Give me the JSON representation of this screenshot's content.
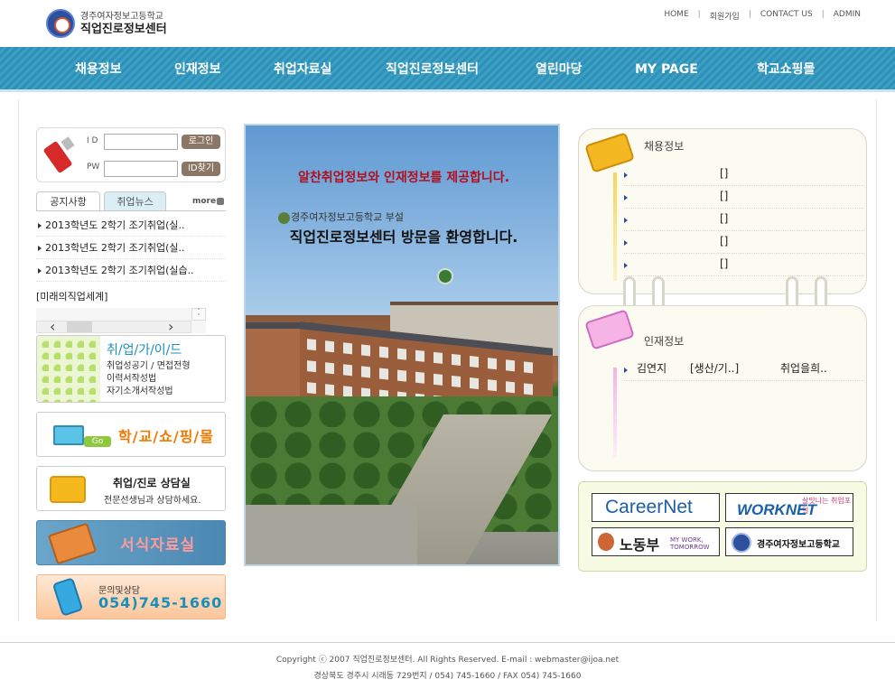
{
  "header": {
    "school_name": "경주여자정보고등학교",
    "site_name": "직업진로정보센터",
    "top_links": [
      "HOME",
      "회원가입",
      "CONTACT US",
      "ADMIN"
    ]
  },
  "nav": {
    "items": [
      "채용정보",
      "인재정보",
      "취업자료실",
      "직업진로정보센터",
      "열린마당",
      "MY PAGE",
      "학교쇼핑몰"
    ]
  },
  "login": {
    "id_label": "I D",
    "pw_label": "PW",
    "login_button": "로그인",
    "find_id_button": "ID찾기"
  },
  "news": {
    "tabs": [
      "공지사항",
      "취업뉴스"
    ],
    "more_label": "more",
    "items": [
      "2013학년도 2학기 조기취업(실..",
      "2013학년도 2학기 조기취업(실..",
      "2013학년도 2학기 조기취업(실습.."
    ],
    "future_link": "[미래의직업세계]"
  },
  "banners": {
    "guide_title": "취/업/가/이/드",
    "guide_lines": [
      "취업성공기 / 면접전형",
      "이력서작성법",
      "자기소개서작성법"
    ],
    "shop_go": "Go",
    "shop_text": "학/교/쇼/핑/몰",
    "counsel_title": "취업/진로 상담실",
    "counsel_sub": "전문선생님과 상담하세요.",
    "forms_text": "서식자료실",
    "phone_sub": "문의및상담",
    "phone_number": "054)745-1660"
  },
  "photo": {
    "headline": "알찬취업정보와 인재정보를 제공합니다.",
    "school_tag": "경주여자정보고등학교 부설",
    "welcome": "직업진로정보센터 방문을 환영합니다."
  },
  "jobs": {
    "title": "채용정보",
    "rows": [
      "[]",
      "[]",
      "[]",
      "[]",
      "[]"
    ]
  },
  "talent": {
    "title": "인재정보",
    "rows": [
      {
        "name": "김연지",
        "field": "[생산/기..]",
        "want": "취업을희.."
      }
    ]
  },
  "links": {
    "careernet": "CareerNet",
    "worknet": "WORKNET",
    "worknet_tag": "살맛나는 취업포털",
    "labor": "노동부",
    "labor_tag": "MY WORK, TOMORROW",
    "school": "경주여자정보고등학교"
  },
  "footer": {
    "copyright": "Copyright ⓒ 2007 직업진로정보센터. All Rights Reserved.  E-mail : webmaster@ijoa.net",
    "address": "경상북도 경주시 시래동 729번지 /  054) 745-1660  /  FAX 054) 745-1660"
  },
  "colors": {
    "nav_blue": "#2f8fb4",
    "headline_red": "#b01020",
    "accent_orange": "#f07800",
    "phone_blue": "#1b8fb8"
  }
}
